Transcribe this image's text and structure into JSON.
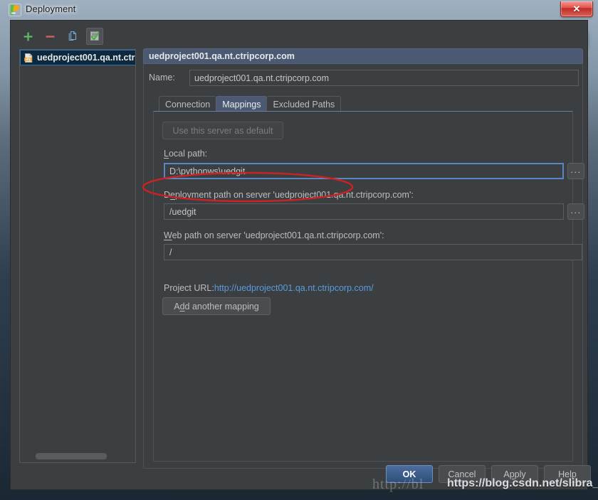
{
  "window": {
    "title": "Deployment",
    "app_icon": "pycharm-icon",
    "close_label": "✕"
  },
  "sidebar": {
    "toolbar": [
      {
        "name": "add-server-button",
        "icon": "plus-icon",
        "glyph": "+"
      },
      {
        "name": "remove-server-button",
        "icon": "minus-icon",
        "glyph": "−"
      },
      {
        "name": "copy-server-button",
        "icon": "copy-icon",
        "glyph": "⧉"
      },
      {
        "name": "set-default-button",
        "icon": "checkmark-document-icon",
        "glyph": "✔"
      }
    ],
    "items": [
      {
        "label": "uedproject001.qa.nt.ctr",
        "icon": "sftp-file-icon"
      }
    ]
  },
  "pane": {
    "header_title": "uedproject001.qa.nt.ctripcorp.com",
    "name_label": "Name:",
    "name_value": "uedproject001.qa.nt.ctripcorp.com",
    "tabs": [
      {
        "label": "Connection",
        "active": false
      },
      {
        "label": "Mappings",
        "active": true
      },
      {
        "label": "Excluded Paths",
        "active": false
      }
    ]
  },
  "mappings": {
    "use_default_button": "Use this server as default",
    "local_path_label": "Local path:",
    "local_path_value": "D:\\pythonws\\uedgit",
    "deployment_path_label": "Deployment path on server 'uedproject001.qa.nt.ctripcorp.com':",
    "deployment_path_value": "/uedgit",
    "web_path_label": "Web path on server 'uedproject001.qa.nt.ctripcorp.com':",
    "web_path_value": "/",
    "project_url_label": "Project URL:",
    "project_url_link": "http://uedproject001.qa.nt.ctripcorp.com/",
    "add_mapping_button": "Add another mapping",
    "browse_button": "...",
    "annotation": {
      "shape": "ellipse",
      "color": "#cc2222"
    }
  },
  "buttons": {
    "ok": "OK",
    "cancel": "Cancel",
    "apply": "Apply",
    "help": "Help"
  },
  "watermarks": {
    "faint": "http://bl",
    "main": "https://blog.csdn.net/slibra_l"
  },
  "colors": {
    "dialog_bg": "#3c3f41",
    "accent_blue": "#4b5a72",
    "link_blue": "#5b9adc",
    "focus_border": "#5b86c4",
    "annotation_red": "#cc2222",
    "selection_bg": "#0d293e"
  }
}
